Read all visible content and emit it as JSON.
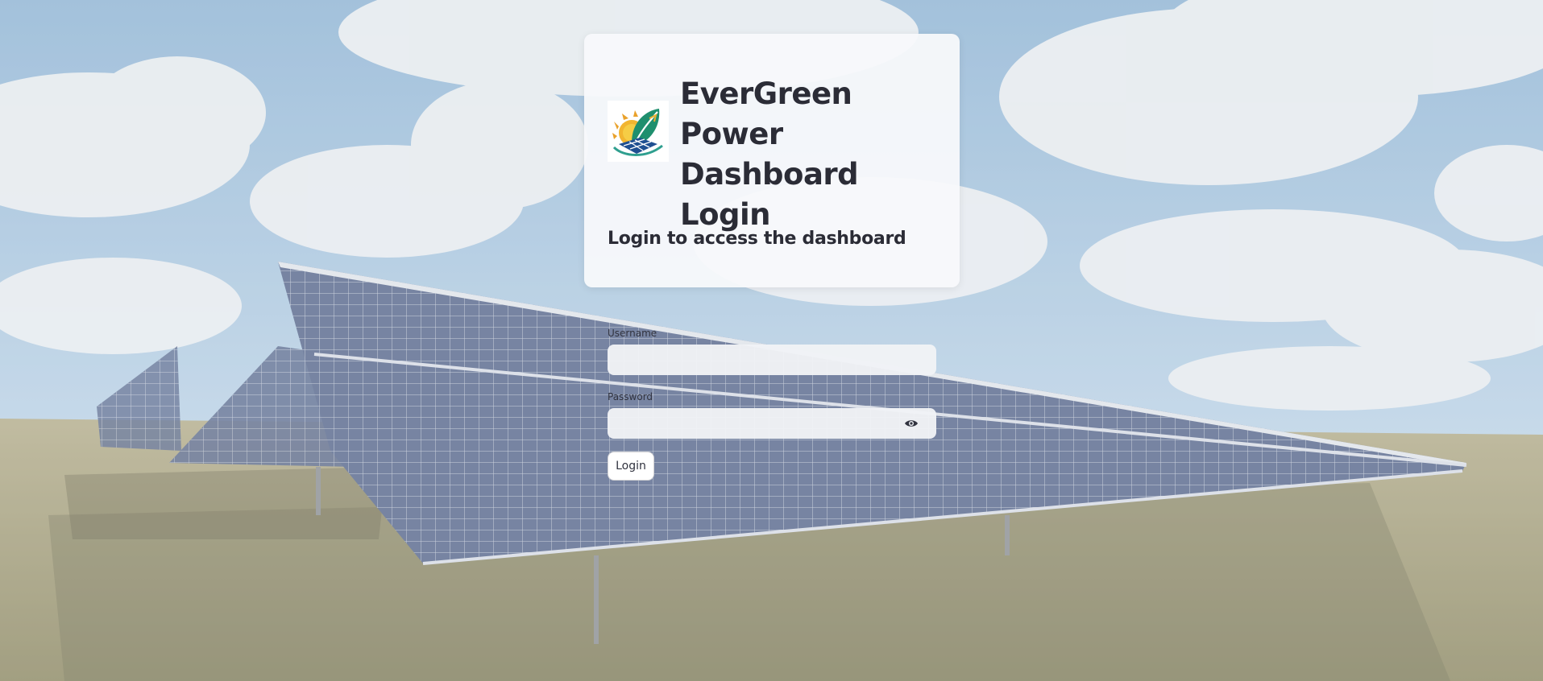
{
  "login_card": {
    "title": "EverGreen Power Dashboard Login",
    "subtitle": "Login to access the dashboard",
    "logo_icon": "evergreen-leaf-sun-solar-logo"
  },
  "form": {
    "username_label": "Username",
    "username_value": "",
    "password_label": "Password",
    "password_value": "",
    "password_toggle_icon": "eye-icon",
    "login_button_label": "Login"
  },
  "background": {
    "scene": "solar-farm-photo",
    "colors": {
      "sky": "#8fb6d6",
      "cloud": "#e9edf0",
      "panel": "#5d6b8c",
      "grass": "#a39c78"
    }
  }
}
